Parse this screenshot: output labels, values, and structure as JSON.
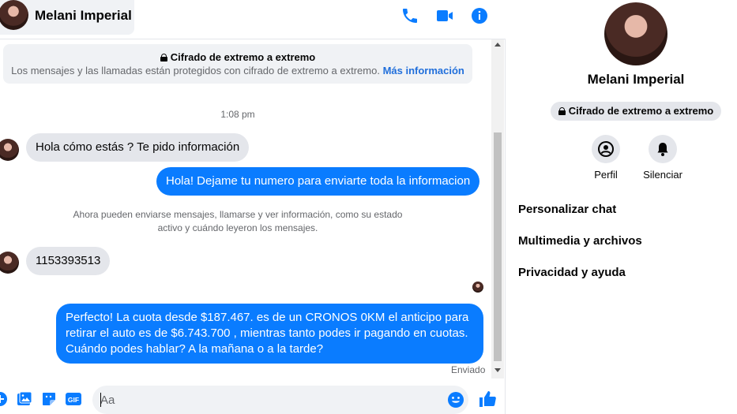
{
  "header": {
    "contact_name": "Melani Imperial",
    "icons": [
      "phone-icon",
      "video-call-icon",
      "info-icon"
    ]
  },
  "encryption_notice": {
    "title": "Cifrado de extremo a extremo",
    "body": "Los mensajes y las llamadas están protegidos con cifrado de extremo a extremo.",
    "link": "Más información"
  },
  "conversation": {
    "timestamp": "1:08 pm",
    "msg1": "Hola cómo estás ? Te pido información",
    "msg2": "Hola! Dejame tu numero  para enviarte toda la informacion",
    "system_line1": "Ahora pueden enviarse mensajes, llamarse y ver información, como su estado",
    "system_line2": "activo y cuándo leyeron los mensajes.",
    "msg3": "1153393513",
    "msg4_line1": "Perfecto! La cuota desde $187.467. es de un CRONOS 0KM el anticipo para",
    "msg4_line2": "retirar el auto es de $6.743.700 , mientras tanto podes ir pagando en cuotas.",
    "msg4_line3": "Cuándo podes hablar? A la mañana o a la tarde?",
    "status": "Enviado"
  },
  "composer": {
    "placeholder": "Aa",
    "icons": [
      "more-actions-icon",
      "photo-icon",
      "sticker-icon",
      "gif-icon",
      "emoji-icon",
      "like-icon"
    ],
    "gif_label": "GIF"
  },
  "panel": {
    "name": "Melani Imperial",
    "encryption_pill": "Cifrado de extremo a extremo",
    "profile_label": "Perfil",
    "mute_label": "Silenciar",
    "menu": [
      "Personalizar chat",
      "Multimedia y archivos",
      "Privacidad y ayuda"
    ]
  },
  "colors": {
    "accent": "#0a7cff",
    "incoming_bubble": "#e4e6eb",
    "link": "#216fdb"
  }
}
